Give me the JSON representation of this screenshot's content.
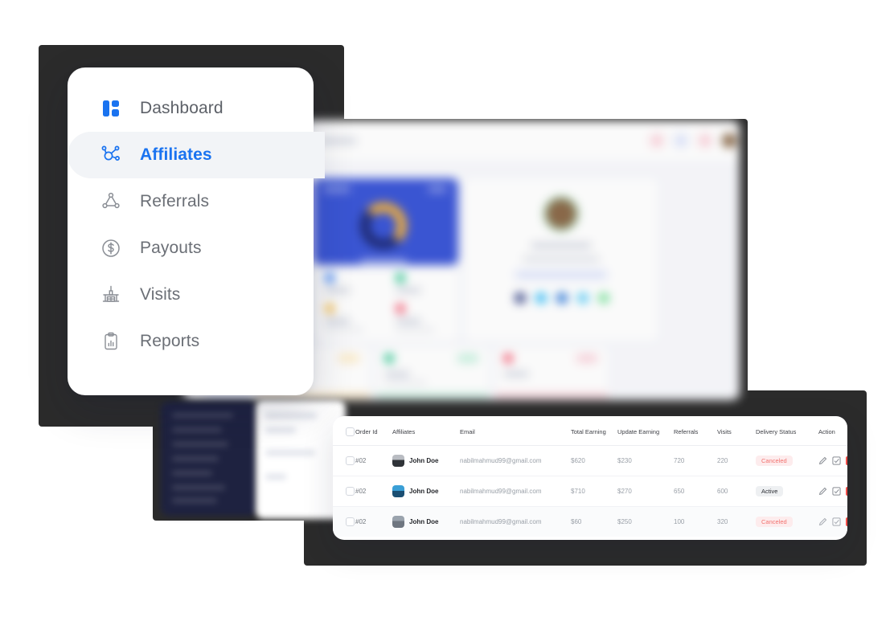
{
  "theme": {
    "accent": "#1a73f0",
    "menu_bg": "#ffffff",
    "active_item_bg": "#f2f4f7",
    "danger": "#f4504b",
    "canceled_text": "#f2726f",
    "canceled_bg": "#fdeced",
    "active_badge_bg": "#eef0f2",
    "panel_dark": "#2b2b2b"
  },
  "menu": {
    "items": [
      {
        "label": "Dashboard",
        "icon": "grid-blocks-icon",
        "active": false
      },
      {
        "label": "Affiliates",
        "icon": "network-hub-icon",
        "active": true
      },
      {
        "label": "Referrals",
        "icon": "triangle-network-icon",
        "active": false
      },
      {
        "label": "Payouts",
        "icon": "dollar-circle-icon",
        "active": false
      },
      {
        "label": "Visits",
        "icon": "kiosk-building-icon",
        "active": false
      },
      {
        "label": "Reports",
        "icon": "clipboard-chart-icon",
        "active": false
      }
    ]
  },
  "table": {
    "columns": [
      "",
      "Order Id",
      "Affiliates",
      "Email",
      "Total Earning",
      "Update Earning",
      "Referrals",
      "Visits",
      "Delivery Status",
      "Action"
    ],
    "rows": [
      {
        "order_id": "#02",
        "affiliate": "John Doe",
        "email": "nabilmahmud99@gmail.com",
        "total_earning": "$620",
        "update_earning": "$230",
        "referrals": "720",
        "visits": "220",
        "status": "Canceled",
        "status_kind": "canceled",
        "avatar": "avatar-dark-suit"
      },
      {
        "order_id": "#02",
        "affiliate": "John Doe",
        "email": "nabilmahmud99@gmail.com",
        "total_earning": "$710",
        "update_earning": "$270",
        "referrals": "650",
        "visits": "600",
        "status": "Active",
        "status_kind": "active",
        "avatar": "avatar-blue-bg"
      },
      {
        "order_id": "#02",
        "affiliate": "John Doe",
        "email": "nabilmahmud99@gmail.com",
        "total_earning": "$60",
        "update_earning": "$250",
        "referrals": "100",
        "visits": "320",
        "status": "Canceled",
        "status_kind": "canceled",
        "avatar": "avatar-grey-bg"
      }
    ],
    "row_actions": [
      "edit-pencil-icon",
      "approve-checkbox-icon",
      "delete-trash-icon"
    ]
  }
}
